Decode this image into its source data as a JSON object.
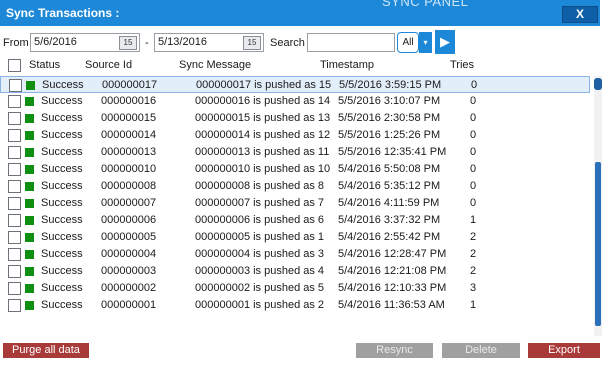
{
  "window": {
    "title": "Sync Transactions :",
    "behind_text": "SYNC PANEL",
    "close_label": "X"
  },
  "filter": {
    "from_label": "From",
    "from_date": "5/6/2016",
    "to_separator": "-",
    "to_date": "5/13/2016",
    "calendar_glyph": "15",
    "search_label": "Search",
    "search_value": "",
    "scope_value": "All",
    "dropdown_glyph": "▾",
    "go_glyph": "▶"
  },
  "grid": {
    "columns": [
      "Status",
      "Source Id",
      "Sync Message",
      "Timestamp",
      "Tries"
    ],
    "status_color": "#109010",
    "rows": [
      {
        "status": "Success",
        "source_id": "000000017",
        "message": "000000017 is pushed as 15",
        "timestamp": "5/5/2016 3:59:15 PM",
        "tries": "0",
        "selected": true
      },
      {
        "status": "Success",
        "source_id": "000000016",
        "message": "000000016 is pushed as 14",
        "timestamp": "5/5/2016 3:10:07 PM",
        "tries": "0"
      },
      {
        "status": "Success",
        "source_id": "000000015",
        "message": "000000015 is pushed as 13",
        "timestamp": "5/5/2016 2:30:58 PM",
        "tries": "0"
      },
      {
        "status": "Success",
        "source_id": "000000014",
        "message": "000000014 is pushed as 12",
        "timestamp": "5/5/2016 1:25:26 PM",
        "tries": "0"
      },
      {
        "status": "Success",
        "source_id": "000000013",
        "message": "000000013 is pushed as 11",
        "timestamp": "5/5/2016 12:35:41 PM",
        "tries": "0"
      },
      {
        "status": "Success",
        "source_id": "000000010",
        "message": "000000010 is pushed as 10",
        "timestamp": "5/4/2016 5:50:08 PM",
        "tries": "0"
      },
      {
        "status": "Success",
        "source_id": "000000008",
        "message": "000000008 is pushed as 8",
        "timestamp": "5/4/2016 5:35:12 PM",
        "tries": "0"
      },
      {
        "status": "Success",
        "source_id": "000000007",
        "message": "000000007 is pushed as 7",
        "timestamp": "5/4/2016 4:11:59 PM",
        "tries": "0"
      },
      {
        "status": "Success",
        "source_id": "000000006",
        "message": "000000006 is pushed as 6",
        "timestamp": "5/4/2016 3:37:32 PM",
        "tries": "1"
      },
      {
        "status": "Success",
        "source_id": "000000005",
        "message": "000000005 is pushed as 1",
        "timestamp": "5/4/2016 2:55:42 PM",
        "tries": "2"
      },
      {
        "status": "Success",
        "source_id": "000000004",
        "message": "000000004 is pushed as 3",
        "timestamp": "5/4/2016 12:28:47 PM",
        "tries": "2"
      },
      {
        "status": "Success",
        "source_id": "000000003",
        "message": "000000003 is pushed as 4",
        "timestamp": "5/4/2016 12:21:08 PM",
        "tries": "2"
      },
      {
        "status": "Success",
        "source_id": "000000002",
        "message": "000000002 is pushed as 5",
        "timestamp": "5/4/2016 12:10:33 PM",
        "tries": "3"
      },
      {
        "status": "Success",
        "source_id": "000000001",
        "message": "000000001 is pushed as 2",
        "timestamp": "5/4/2016 11:36:53 AM",
        "tries": "1"
      }
    ]
  },
  "footer": {
    "purge_label": "Purge all data",
    "resync_label": "Resync",
    "delete_label": "Delete",
    "export_label": "Export"
  }
}
